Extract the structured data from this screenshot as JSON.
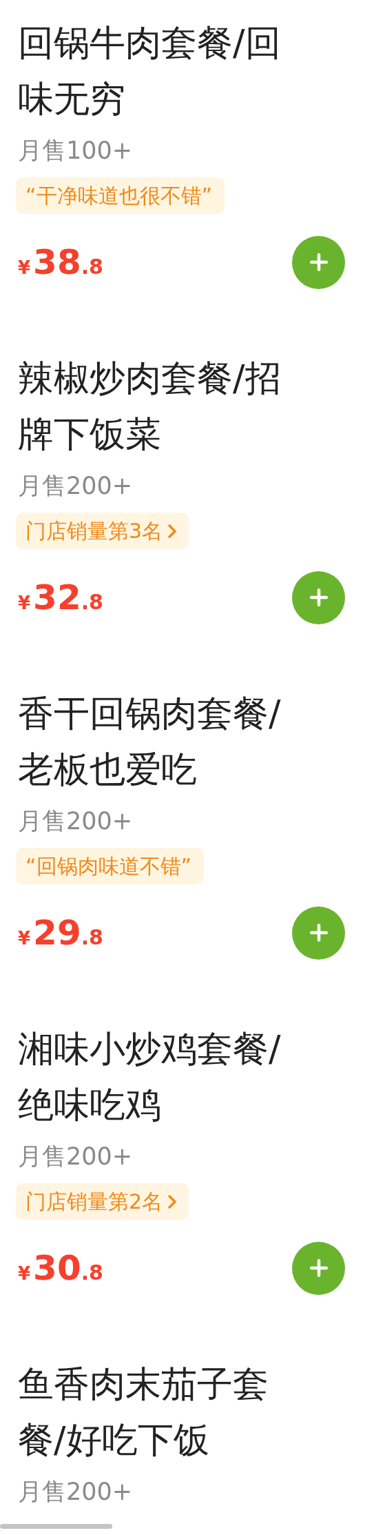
{
  "items": [
    {
      "title": "回锅牛肉套餐/回味无穷",
      "sales": "月售100+",
      "tag": {
        "kind": "quote",
        "text": "“干净味道也很不错”"
      },
      "price": {
        "currency": "¥",
        "integer": "38",
        "decimal": ".8"
      }
    },
    {
      "title": "辣椒炒肉套餐/招牌下饭菜",
      "sales": "月售200+",
      "tag": {
        "kind": "rank",
        "text": "门店销量第3名"
      },
      "price": {
        "currency": "¥",
        "integer": "32",
        "decimal": ".8"
      }
    },
    {
      "title": "香干回锅肉套餐/老板也爱吃",
      "sales": "月售200+",
      "tag": {
        "kind": "quote",
        "text": "“回锅肉味道不错”"
      },
      "price": {
        "currency": "¥",
        "integer": "29",
        "decimal": ".8"
      }
    },
    {
      "title": "湘味小炒鸡套餐/绝味吃鸡",
      "sales": "月售200+",
      "tag": {
        "kind": "rank",
        "text": "门店销量第2名"
      },
      "price": {
        "currency": "¥",
        "integer": "30",
        "decimal": ".8"
      }
    },
    {
      "title": "鱼香肉末茄子套餐/好吃下饭",
      "sales": "月售200+"
    }
  ]
}
